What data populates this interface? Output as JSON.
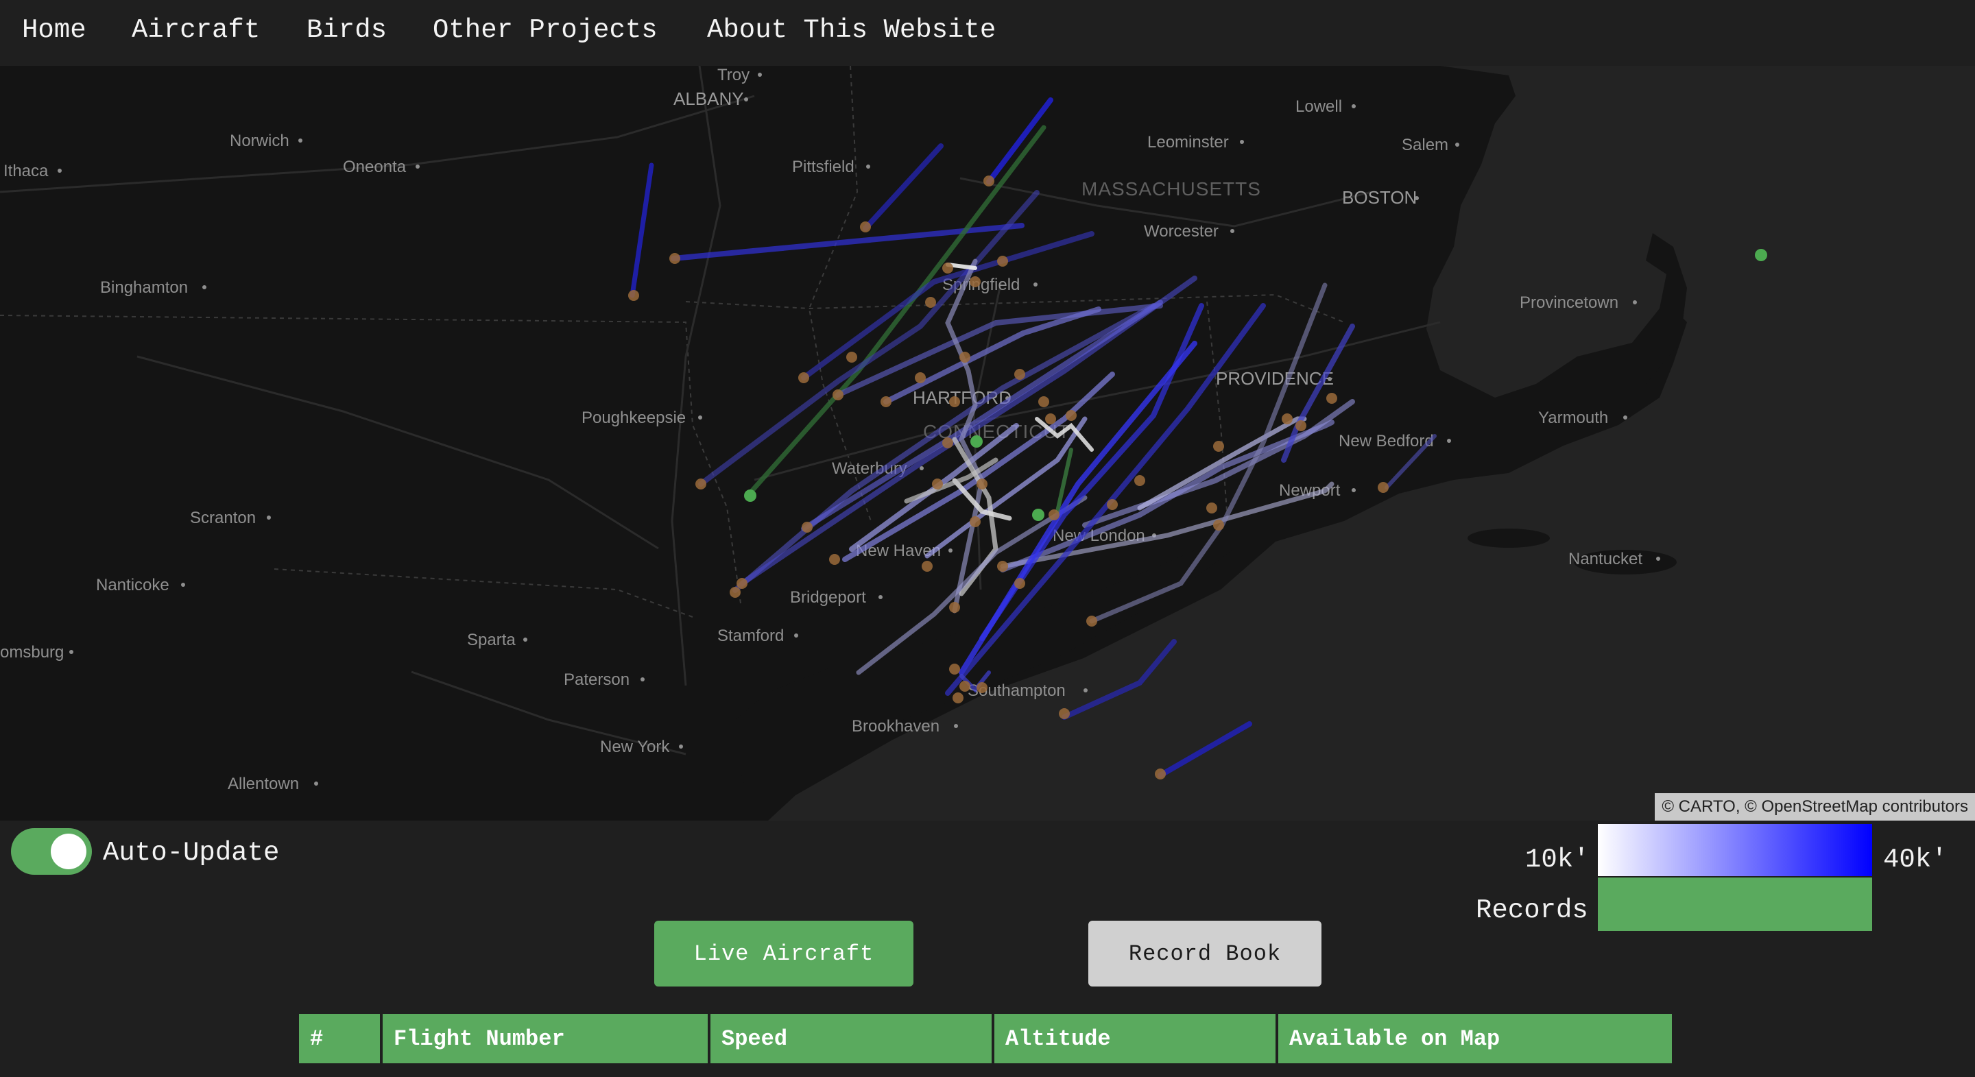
{
  "nav": {
    "items": [
      "Home",
      "Aircraft",
      "Birds",
      "Other Projects",
      "About This Website"
    ]
  },
  "map": {
    "cities": [
      {
        "name": "Troy"
      },
      {
        "name": "ALBANY"
      },
      {
        "name": "Norwich"
      },
      {
        "name": "Ithaca"
      },
      {
        "name": "Oneonta"
      },
      {
        "name": "Pittsfield"
      },
      {
        "name": "Lowell"
      },
      {
        "name": "Leominster"
      },
      {
        "name": "Salem"
      },
      {
        "name": "MASSACHUSETTS"
      },
      {
        "name": "BOSTON"
      },
      {
        "name": "Worcester"
      },
      {
        "name": "Binghamton"
      },
      {
        "name": "Springfield"
      },
      {
        "name": "Provincetown"
      },
      {
        "name": "PROVIDENCE"
      },
      {
        "name": "HARTFORD"
      },
      {
        "name": "Poughkeepsie"
      },
      {
        "name": "Yarmouth"
      },
      {
        "name": "CONNECTICUT"
      },
      {
        "name": "New Bedford"
      },
      {
        "name": "Waterbury"
      },
      {
        "name": "Newport"
      },
      {
        "name": "Scranton"
      },
      {
        "name": "New Haven"
      },
      {
        "name": "New London"
      },
      {
        "name": "Nantucket"
      },
      {
        "name": "Nanticoke"
      },
      {
        "name": "Bridgeport"
      },
      {
        "name": "Stamford"
      },
      {
        "name": "omsburg"
      },
      {
        "name": "Sparta"
      },
      {
        "name": "Paterson"
      },
      {
        "name": "Southampton"
      },
      {
        "name": "Brookhaven"
      },
      {
        "name": "New York"
      },
      {
        "name": "Allentown"
      }
    ],
    "attribution": "© CARTO, © OpenStreetMap contributors"
  },
  "controls": {
    "auto_update_label": "Auto-Update",
    "auto_update_on": true
  },
  "legend": {
    "low_label": "10k'",
    "high_label": "40k'",
    "records_label": "Records",
    "gradient_start": "#ffffff",
    "gradient_end": "#0000ff",
    "records_color": "#5aaa5e"
  },
  "buttons": {
    "live": "Live Aircraft",
    "record": "Record Book"
  },
  "table": {
    "headers": [
      "#",
      "Flight Number",
      "Speed",
      "Altitude",
      "Available on Map"
    ]
  },
  "colors": {
    "accent": "#5aaa5e",
    "background": "#1f1f1f",
    "map_background": "#151515"
  }
}
